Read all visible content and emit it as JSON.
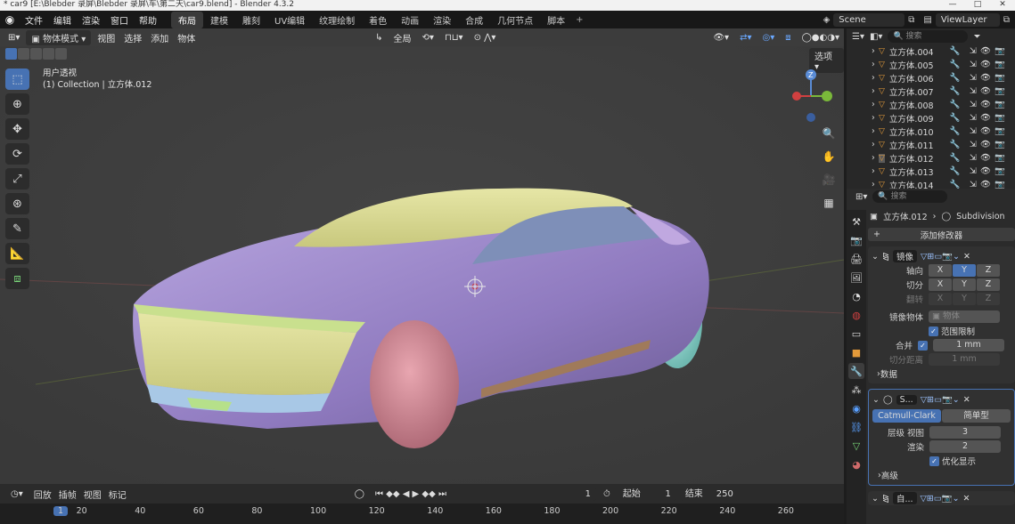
{
  "window": {
    "title": "* car9 [E:\\Blebder 录屏\\Blebder 录屏\\车\\第二天\\car9.blend] - Blender 4.3.2",
    "min": "—",
    "max": "□",
    "close": "✕"
  },
  "topbar": {
    "menu": [
      "文件",
      "编辑",
      "渲染",
      "窗口",
      "帮助"
    ],
    "tabs": [
      {
        "label": "布局",
        "active": true
      },
      {
        "label": "建模"
      },
      {
        "label": "雕刻"
      },
      {
        "label": "UV编辑"
      },
      {
        "label": "纹理绘制"
      },
      {
        "label": "着色"
      },
      {
        "label": "动画"
      },
      {
        "label": "渲染"
      },
      {
        "label": "合成"
      },
      {
        "label": "几何节点"
      },
      {
        "label": "脚本"
      }
    ],
    "add_tab": "+",
    "scene": "Scene",
    "view_layer": "ViewLayer"
  },
  "viewport": {
    "mode": "物体模式",
    "menu": [
      "视图",
      "选择",
      "添加",
      "物体"
    ],
    "orientation": "全局",
    "options": "选项",
    "view_name": "用户透视",
    "collection_label": "(1) Collection | 立方体.012",
    "axis_z": "Z",
    "axis_y": "Y"
  },
  "timeline": {
    "menu": [
      "回放",
      "插帧",
      "视图",
      "标记"
    ],
    "current_frame": "1",
    "start_label": "起始",
    "start": "1",
    "end_label": "结束",
    "end": "250",
    "ruler": [
      "1",
      "20",
      "40",
      "60",
      "80",
      "100",
      "120",
      "140",
      "160",
      "180",
      "200",
      "220",
      "240",
      "260"
    ]
  },
  "outliner": {
    "search_placeholder": "搜索",
    "items": [
      {
        "name": "立方体.004"
      },
      {
        "name": "立方体.005"
      },
      {
        "name": "立方体.006"
      },
      {
        "name": "立方体.007"
      },
      {
        "name": "立方体.008"
      },
      {
        "name": "立方体.009"
      },
      {
        "name": "立方体.010"
      },
      {
        "name": "立方体.011"
      },
      {
        "name": "立方体.012",
        "selected": true
      },
      {
        "name": "立方体.013"
      },
      {
        "name": "立方体.014"
      }
    ]
  },
  "properties": {
    "search_placeholder": "搜索",
    "object": "立方体.012",
    "modifier": "Subdivision",
    "add_modifier": "添加修改器",
    "mirror": {
      "name": "镜像",
      "axis_label": "轴向",
      "bisect_label": "切分",
      "flip_label": "翻转",
      "axes": [
        "X",
        "Y",
        "Z"
      ],
      "mirror_object_label": "镜像物体",
      "mirror_object_placeholder": "物体",
      "clipping": "范围限制",
      "merge_label": "合并",
      "merge_value": "1 mm",
      "bisect_dist_label": "切分距离",
      "bisect_dist_value": "1 mm",
      "data": "数据"
    },
    "subdiv": {
      "name": "S...",
      "catmull": "Catmull-Clark",
      "simple": "简单型",
      "levels_label": "层级 视图",
      "levels": "3",
      "render_label": "渲染",
      "render": "2",
      "optimal": "优化显示",
      "advanced": "高级"
    },
    "next_mod": "自..."
  }
}
